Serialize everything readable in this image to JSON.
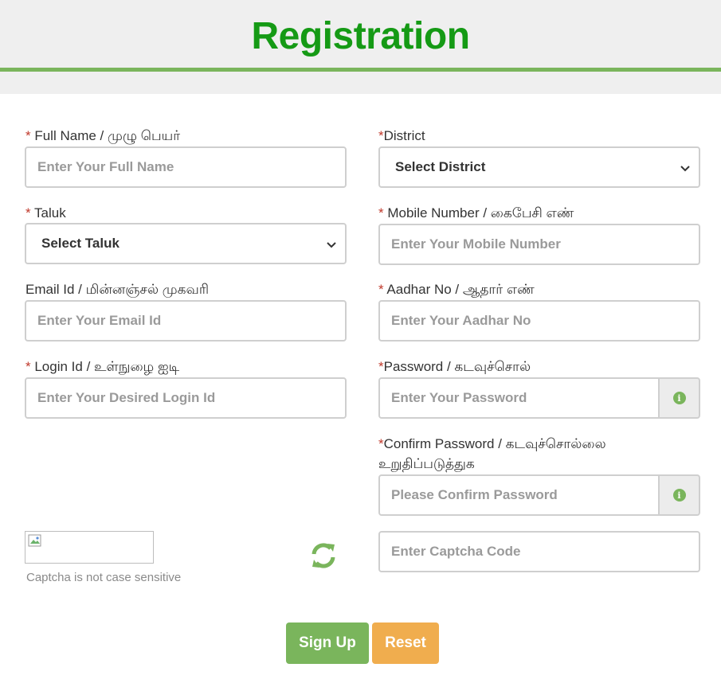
{
  "header": {
    "title": "Registration"
  },
  "form": {
    "full_name": {
      "label": " Full Name / முழு பெயர்",
      "placeholder": "Enter Your Full Name"
    },
    "district": {
      "label": "District",
      "selected": "Select District"
    },
    "taluk": {
      "label": " Taluk",
      "selected": "Select Taluk"
    },
    "mobile": {
      "label": " Mobile Number / கைபேசி எண்",
      "placeholder": "Enter Your Mobile Number"
    },
    "email": {
      "label": "Email Id / மின்னஞ்சல் முகவரி",
      "placeholder": "Enter Your Email Id"
    },
    "aadhar": {
      "label": " Aadhar No / ஆதார் எண்",
      "placeholder": "Enter Your Aadhar No"
    },
    "login_id": {
      "label": " Login Id / உள்நுழை ஐடி",
      "placeholder": "Enter Your Desired Login Id"
    },
    "password": {
      "label": "Password / கடவுச்சொல்",
      "placeholder": "Enter Your Password"
    },
    "confirm_password": {
      "label_line1": "Confirm Password / கடவுச்சொல்லை",
      "label_line2": "உறுதிப்படுத்துக",
      "placeholder": "Please Confirm Password"
    },
    "captcha": {
      "note": "Captcha is not case sensitive",
      "placeholder": "Enter Captcha Code"
    },
    "required_marker": "*"
  },
  "buttons": {
    "signup": "Sign Up",
    "reset": "Reset"
  },
  "icons": {
    "info": "info-icon",
    "refresh": "refresh-icon",
    "chevron": "chevron-down-icon",
    "broken_image": "broken-image-icon"
  },
  "colors": {
    "title_green": "#159a15",
    "accent_green": "#7ab55c",
    "reset_orange": "#f0ad4e",
    "required_red": "#c0392b"
  }
}
